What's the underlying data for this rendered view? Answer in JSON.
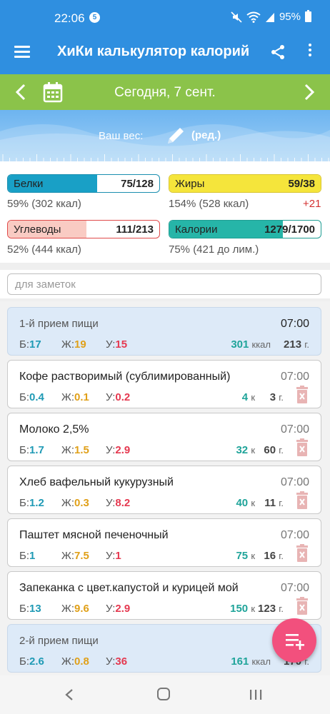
{
  "status": {
    "time": "22:06",
    "badge": "5",
    "battery": "95%"
  },
  "appbar": {
    "title": "ХиКи калькулятор калорий"
  },
  "datebar": {
    "label": "Сегодня, 7 сент."
  },
  "weight": {
    "label": "Ваш вес:",
    "edit": "(ред.)"
  },
  "macros": {
    "protein": {
      "name": "Белки",
      "value": "75/128",
      "sub": "59% (302 ккал)",
      "fill": 0.59,
      "color": "#19a0c6"
    },
    "fat": {
      "name": "Жиры",
      "value": "59/38",
      "sub": "154% (528 ккал)",
      "extra": "+21",
      "fill": 1.0,
      "color": "#f5e53b"
    },
    "carbs": {
      "name": "Углеводы",
      "value": "111/213",
      "sub": "52% (444 ккал)",
      "fill": 0.52,
      "color": "#f9cbc3"
    },
    "calories": {
      "name": "Калории",
      "value": "1279/1700",
      "sub": "75% (421 до лим.)",
      "fill": 0.75,
      "color": "#26b5a8"
    }
  },
  "notes": {
    "placeholder": "для заметок"
  },
  "labels": {
    "p": "Б:",
    "f": "Ж:",
    "c": "У:",
    "kcal": "ккал",
    "k": "к",
    "g": "г."
  },
  "entries": [
    {
      "type": "meal",
      "title": "1-й прием пищи",
      "time": "07:00",
      "p": "17",
      "f": "19",
      "c": "15",
      "kcal": "301",
      "weight": "213"
    },
    {
      "type": "food",
      "title": "Кофе растворимый (сублимированный)",
      "time": "07:00",
      "p": "0.4",
      "f": "0.1",
      "c": "0.2",
      "kcal": "4",
      "weight": "3"
    },
    {
      "type": "food",
      "title": "Молоко 2,5%",
      "time": "07:00",
      "p": "1.7",
      "f": "1.5",
      "c": "2.9",
      "kcal": "32",
      "weight": "60"
    },
    {
      "type": "food",
      "title": "Хлеб вафельный кукурузный",
      "time": "07:00",
      "p": "1.2",
      "f": "0.3",
      "c": "8.2",
      "kcal": "40",
      "weight": "11"
    },
    {
      "type": "food",
      "title": "Паштет мясной печеночный",
      "time": "07:00",
      "p": "1",
      "f": "7.5",
      "c": "1",
      "kcal": "75",
      "weight": "16"
    },
    {
      "type": "food",
      "title": "Запеканка с цвет.капустой и курицей мой",
      "time": "07:00",
      "p": "13",
      "f": "9.6",
      "c": "2.9",
      "kcal": "150",
      "weight": "123"
    },
    {
      "type": "meal",
      "title": "2-й прием пищи",
      "time": "",
      "p": "2.6",
      "f": "0.8",
      "c": "36",
      "kcal": "161",
      "weight": "170"
    }
  ]
}
